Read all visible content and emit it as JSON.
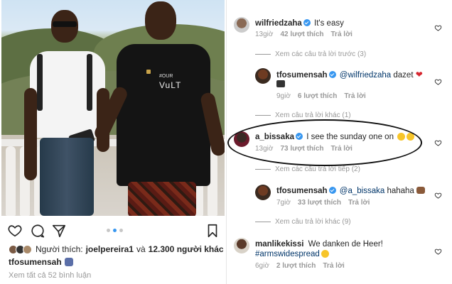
{
  "post": {
    "carousel": {
      "count": 3,
      "active": 1
    },
    "likes": {
      "prefix": "Người thích:",
      "user": "joelpereira1",
      "connector": "và",
      "others": "12.300 người khác"
    },
    "caption_user": "tfosumensah",
    "view_all_comments": "Xem tất cả 52 bình luận",
    "shirt_text": "VuLT",
    "shirt_small": "#OUR"
  },
  "comments": {
    "c1": {
      "user": "wilfriedzaha",
      "text": "It's easy",
      "time": "13giờ",
      "likes": "42 lượt thích",
      "reply": "Trả lời"
    },
    "more1": {
      "text": "Xem các câu trả lời trước (3)"
    },
    "c2": {
      "user": "tfosumensah",
      "mention": "@wilfriedzaha",
      "text": " dazet",
      "time": "9giờ",
      "likes": "6 lượt thích",
      "reply": "Trả lời"
    },
    "more2": {
      "text": "Xem câu trả lời khác (1)"
    },
    "c3": {
      "user": "a_bissaka",
      "text": "I see the sunday one on",
      "time": "13giờ",
      "likes": "73 lượt thích",
      "reply": "Trả lời"
    },
    "more3": {
      "text": "Xem các câu trả lời tiếp (2)"
    },
    "c4": {
      "user": "tfosumensah",
      "mention": "@a_bissaka",
      "text": " hahaha",
      "time": "7giờ",
      "likes": "33 lượt thích",
      "reply": "Trả lời"
    },
    "more4": {
      "text": "Xem câu trả lời khác (9)"
    },
    "c5": {
      "user": "manlikekissi",
      "text": "We danken de Heer!",
      "hashtag": "#armswidespread",
      "time": "6giờ",
      "likes": "2 lượt thích",
      "reply": "Trả lời"
    }
  },
  "icons": [
    "heart-icon",
    "comment-icon",
    "share-icon",
    "bookmark-icon",
    "verified-icon"
  ],
  "colors": {
    "link": "#003569",
    "meta": "#999999",
    "accent": "#3897f0",
    "heart": "#d6262f"
  }
}
